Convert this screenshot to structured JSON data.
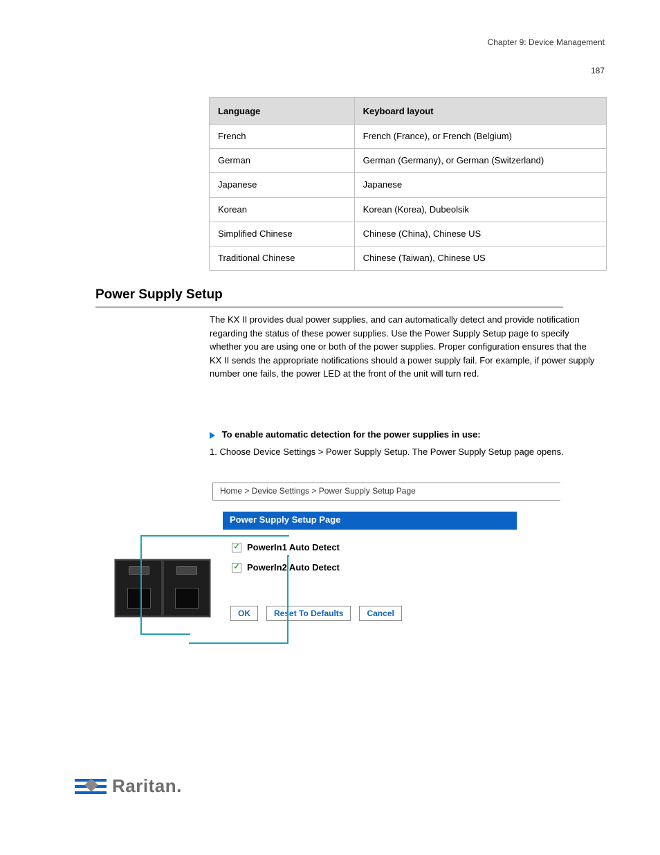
{
  "page_header": "Chapter 9: Device Management",
  "page_number": "187",
  "table": {
    "headers": {
      "language": "Language",
      "sample": "Keyboard layout"
    },
    "rows": [
      {
        "language": "French",
        "sample": "French (France), or French (Belgium)"
      },
      {
        "language": "German",
        "sample": "German (Germany), or German (Switzerland)"
      },
      {
        "language": "Japanese",
        "sample": "Japanese"
      },
      {
        "language": "Korean",
        "sample": "Korean (Korea), Dubeolsik"
      },
      {
        "language": "Simplified Chinese",
        "sample": "Chinese (China), Chinese US"
      },
      {
        "language": "Traditional Chinese",
        "sample": "Chinese (Taiwan), Chinese US"
      }
    ]
  },
  "section_heading": "Power Supply Setup",
  "body_para_1": "The KX II provides dual power supplies, and can automatically detect and provide notification regarding the status of these power supplies. Use the Power Supply Setup page to specify whether you are using one or both of the power supplies. Proper configuration ensures that the KX II sends the appropriate notifications should a power supply fail. For example, if power supply number one fails, the power LED at the front of the unit will turn red.",
  "body_para_2": "",
  "body_para_3": "",
  "step_heading": "To enable automatic detection for the power supplies in use:",
  "step_1": "1. Choose Device Settings > Power Supply Setup. The Power Supply Setup page opens.",
  "diagram": {
    "breadcrumb": "Home > Device Settings > Power Supply Setup Page",
    "panel_title": "Power Supply Setup Page",
    "checkbox1": "PowerIn1 Auto Detect",
    "checkbox2": "PowerIn2 Auto Detect",
    "btn_ok": "OK",
    "btn_reset": "Reset To Defaults",
    "btn_cancel": "Cancel"
  },
  "note_text": "",
  "logo_text": "Raritan."
}
